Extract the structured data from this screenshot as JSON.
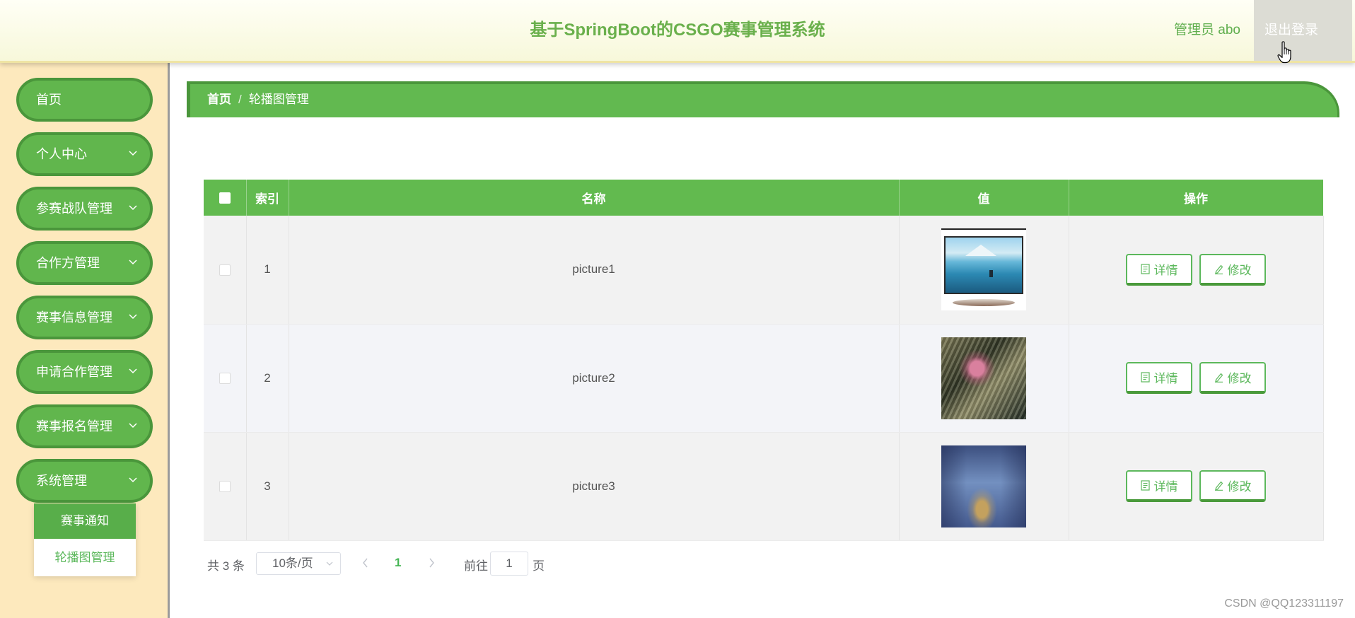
{
  "header": {
    "title": "基于SpringBoot的CSGO赛事管理系统",
    "user_label": "管理员 abo",
    "logout_label": "退出登录"
  },
  "sidebar": {
    "items": [
      {
        "label": "首页"
      },
      {
        "label": "个人中心",
        "icon": "chevron-down-icon"
      },
      {
        "label": "参赛战队管理",
        "icon": "chevron-down-icon"
      },
      {
        "label": "合作方管理",
        "icon": "chevron-down-icon"
      },
      {
        "label": "赛事信息管理",
        "icon": "chevron-down-icon"
      },
      {
        "label": "申请合作管理",
        "icon": "chevron-down-icon"
      },
      {
        "label": "赛事报名管理",
        "icon": "chevron-down-icon"
      },
      {
        "label": "系统管理",
        "icon": "chevron-down-icon",
        "expanded": true
      }
    ],
    "submenu": [
      {
        "label": "赛事通知"
      },
      {
        "label": "轮播图管理",
        "active": true
      }
    ]
  },
  "breadcrumb": {
    "home": "首页",
    "separator": "/",
    "current": "轮播图管理"
  },
  "table": {
    "columns": {
      "index": "索引",
      "name": "名称",
      "value": "值",
      "actions": "操作"
    },
    "rows": [
      {
        "index": "1",
        "name": "picture1"
      },
      {
        "index": "2",
        "name": "picture2"
      },
      {
        "index": "3",
        "name": "picture3"
      }
    ],
    "actions": {
      "detail_label": "详情",
      "detail_icon": "document-icon",
      "edit_label": "修改",
      "edit_icon": "edit-pencil-icon"
    }
  },
  "pagination": {
    "total": "共 3 条",
    "page_size": "10条/页",
    "current_page": "1",
    "goto_label": "前往",
    "goto_value": "1",
    "page_suffix": "页"
  },
  "watermark": "CSDN @QQ123311197",
  "colors": {
    "primary_green": "#5cb85c",
    "dark_green": "#4a963b",
    "title_green": "#6ab04c",
    "sidebar_bg": "#fde9bd",
    "header_bg": "#f7f8da",
    "logout_bg": "#dcdcd4"
  }
}
